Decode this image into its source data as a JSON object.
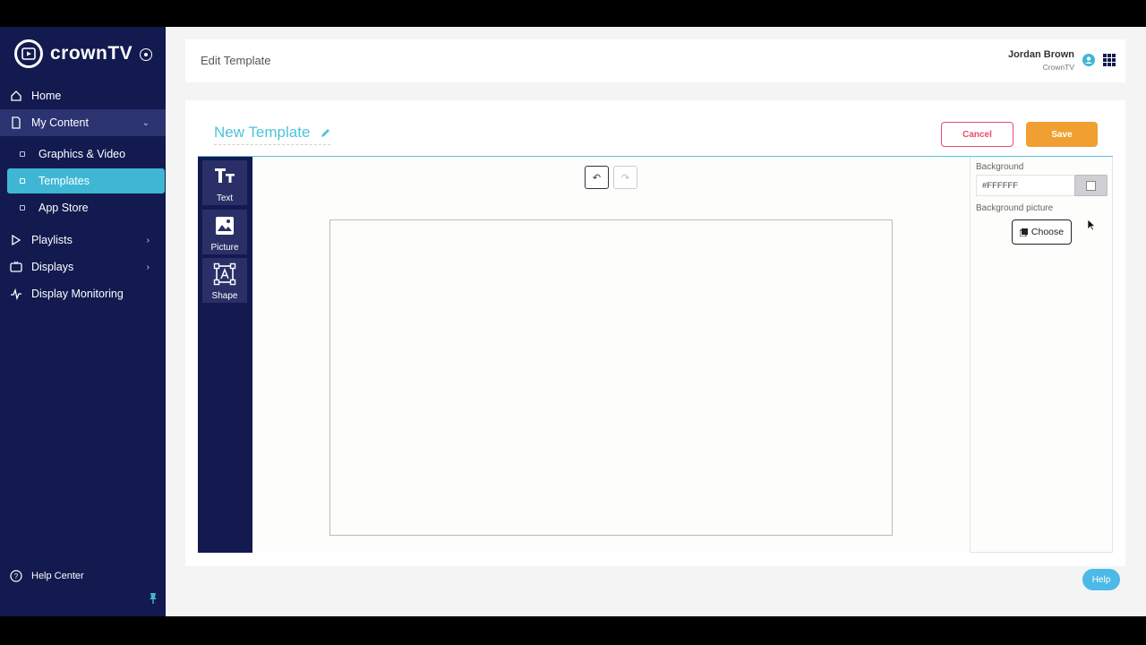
{
  "sidebar": {
    "brand": "crownTV",
    "items": [
      {
        "label": "Home",
        "icon": "home-icon"
      },
      {
        "label": "My Content",
        "icon": "document-icon"
      },
      {
        "label": "Playlists",
        "icon": "play-icon"
      },
      {
        "label": "Displays",
        "icon": "tv-icon"
      },
      {
        "label": "Display Monitoring",
        "icon": "pulse-icon"
      }
    ],
    "sub_items": [
      {
        "label": "Graphics & Video"
      },
      {
        "label": "Templates"
      },
      {
        "label": "App Store"
      }
    ],
    "help_center": "Help Center"
  },
  "header": {
    "title": "Edit Template",
    "user_name": "Jordan Brown",
    "user_org": "CrownTV"
  },
  "editor": {
    "template_name": "New Template",
    "cancel_label": "Cancel",
    "save_label": "Save",
    "tools": [
      {
        "label": "Text",
        "icon": "text-size-icon"
      },
      {
        "label": "Picture",
        "icon": "image-icon"
      },
      {
        "label": "Shape",
        "icon": "shape-icon"
      }
    ],
    "undo_symbol": "↶",
    "redo_symbol": "↷"
  },
  "properties": {
    "background_label": "Background",
    "background_value": "#FFFFFF",
    "background_picture_label": "Background picture",
    "choose_label": "Choose"
  },
  "help_button": "Help",
  "colors": {
    "sidebar": "#121a4f",
    "accent": "#3fb7d4",
    "save": "#f0a030",
    "cancel": "#e74c6e"
  }
}
